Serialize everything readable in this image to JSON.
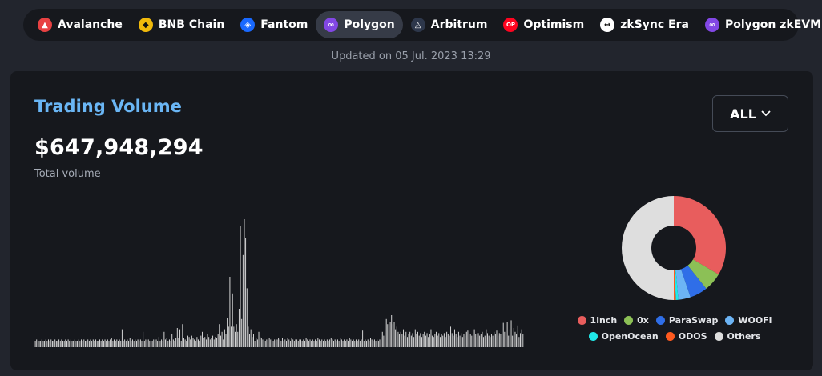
{
  "chains": [
    {
      "label": "Avalanche",
      "icon": "avalanche-icon",
      "color": "#e84142",
      "glyph": "▲"
    },
    {
      "label": "BNB Chain",
      "icon": "bnb-icon",
      "color": "#f0b90b",
      "glyph": "◆"
    },
    {
      "label": "Fantom",
      "icon": "fantom-icon",
      "color": "#1969ff",
      "glyph": "◈"
    },
    {
      "label": "Polygon",
      "icon": "polygon-icon",
      "color": "#8247e5",
      "glyph": "∞",
      "active": true
    },
    {
      "label": "Arbitrum",
      "icon": "arbitrum-icon",
      "color": "#2d374b",
      "glyph": "◬"
    },
    {
      "label": "Optimism",
      "icon": "optimism-icon",
      "color": "#ff0420",
      "glyph": "OP"
    },
    {
      "label": "zkSync Era",
      "icon": "zksync-icon",
      "color": "#ffffff",
      "glyph": "↔"
    },
    {
      "label": "Polygon zkEVM",
      "icon": "polygon-zkevm-icon",
      "color": "#8247e5",
      "glyph": "∞"
    }
  ],
  "updated": "Updated on 05 Jul. 2023 13:29",
  "card": {
    "title": "Trading Volume",
    "total": "$647,948,294",
    "total_label": "Total volume",
    "range_label": "ALL"
  },
  "chart_data": [
    {
      "type": "bar",
      "title": "",
      "xlabel": "",
      "ylabel": "",
      "grid": false,
      "series": [
        {
          "values": [
            4,
            5,
            6,
            5,
            5,
            5,
            6,
            5,
            5,
            6,
            5,
            6,
            5,
            6,
            5,
            5,
            6,
            5,
            5,
            6,
            5,
            6,
            5,
            5,
            6,
            5,
            6,
            5,
            6,
            5,
            5,
            6,
            5,
            5,
            6,
            5,
            6,
            5,
            6,
            5,
            5,
            6,
            5,
            6,
            5,
            6,
            5,
            6,
            5,
            5,
            6,
            5,
            6,
            5,
            6,
            5,
            6,
            5,
            6,
            7,
            5,
            6,
            5,
            6,
            5,
            6,
            5,
            14,
            5,
            6,
            5,
            6,
            5,
            7,
            5,
            6,
            5,
            6,
            5,
            6,
            5,
            6,
            5,
            12,
            5,
            6,
            5,
            6,
            5,
            20,
            5,
            6,
            5,
            6,
            5,
            8,
            5,
            6,
            5,
            12,
            6,
            7,
            5,
            6,
            5,
            10,
            6,
            5,
            7,
            15,
            7,
            14,
            5,
            18,
            7,
            6,
            5,
            9,
            8,
            6,
            9,
            7,
            6,
            5,
            8,
            6,
            5,
            9,
            12,
            7,
            8,
            6,
            10,
            8,
            6,
            7,
            9,
            6,
            8,
            7,
            10,
            18,
            9,
            12,
            6,
            14,
            10,
            23,
            16,
            55,
            16,
            42,
            16,
            12,
            18,
            12,
            30,
            95,
            22,
            72,
            100,
            85,
            46,
            16,
            10,
            14,
            8,
            10,
            5,
            7,
            6,
            12,
            8,
            7,
            6,
            7,
            5,
            6,
            5,
            7,
            6,
            7,
            5,
            6,
            5,
            6,
            7,
            6,
            5,
            7,
            5,
            6,
            5,
            7,
            6,
            5,
            7,
            6,
            5,
            6,
            6,
            5,
            6,
            6,
            5,
            6,
            5,
            7,
            6,
            5,
            6,
            5,
            6,
            5,
            6,
            5,
            7,
            6,
            5,
            6,
            5,
            6,
            5,
            6,
            5,
            6,
            7,
            6,
            5,
            6,
            5,
            6,
            5,
            7,
            6,
            5,
            6,
            5,
            6,
            5,
            7,
            6,
            5,
            6,
            5,
            6,
            5,
            6,
            5,
            6,
            13,
            5,
            6,
            5,
            6,
            5,
            7,
            6,
            5,
            6,
            5,
            6,
            5,
            6,
            8,
            12,
            9,
            15,
            22,
            18,
            35,
            20,
            25,
            18,
            20,
            14,
            16,
            12,
            10,
            12,
            10,
            14,
            9,
            12,
            8,
            10,
            12,
            9,
            11,
            8,
            14,
            10,
            12,
            9,
            11,
            8,
            10,
            12,
            9,
            11,
            8,
            10,
            14,
            9,
            8,
            10,
            12,
            9,
            11,
            8,
            10,
            9,
            11,
            8,
            12,
            10,
            9,
            16,
            11,
            9,
            14,
            10,
            8,
            12,
            9,
            11,
            8,
            10,
            9,
            12,
            13,
            8,
            10,
            9,
            12,
            14,
            10,
            8,
            11,
            9,
            10,
            12,
            8,
            9,
            14,
            11,
            9,
            8,
            10,
            9,
            12,
            10,
            13,
            9,
            11,
            10,
            8,
            19,
            12,
            10,
            20,
            9,
            14,
            21,
            9,
            15,
            12,
            10,
            17,
            8,
            11,
            14,
            10
          ]
        }
      ]
    },
    {
      "type": "pie",
      "title": "",
      "series": [
        {
          "name": "1inch",
          "value": 33.5,
          "color": "#e85d5d"
        },
        {
          "name": "0x",
          "value": 5.8,
          "color": "#8cc056"
        },
        {
          "name": "ParaSwap",
          "value": 5.5,
          "color": "#2f6ee8"
        },
        {
          "name": "WOOFi",
          "value": 3.8,
          "color": "#6cb4f5"
        },
        {
          "name": "OpenOcean",
          "value": 0.8,
          "color": "#20e8e8"
        },
        {
          "name": "ODOS",
          "value": 0.6,
          "color": "#ff5a1f"
        },
        {
          "name": "Others",
          "value": 50.0,
          "color": "#dedede"
        }
      ]
    }
  ]
}
